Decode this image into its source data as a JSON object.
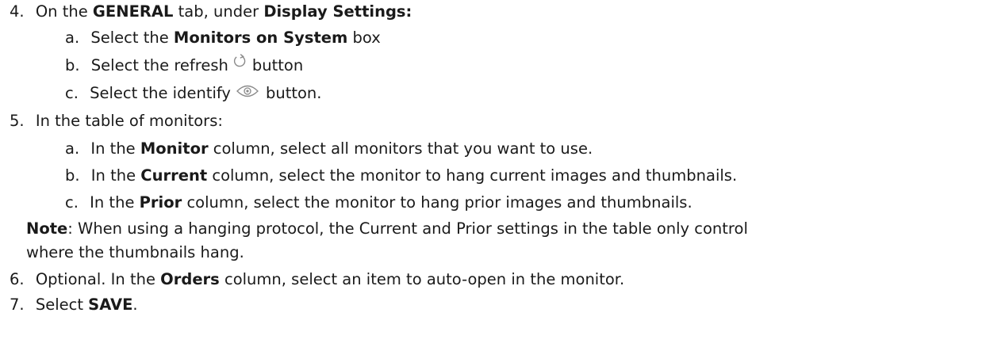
{
  "steps": [
    {
      "num": "4.",
      "parts": [
        "On the ",
        "GENERAL",
        " tab, under ",
        "Display Settings:"
      ],
      "substeps": [
        {
          "letter": "a.",
          "parts": [
            "Select the ",
            "Monitors on System",
            " box"
          ]
        },
        {
          "letter": "b.",
          "parts": [
            "Select the refresh",
            "button"
          ],
          "icon": "refresh-icon"
        },
        {
          "letter": "c.",
          "parts": [
            "Select the identify",
            "button."
          ],
          "icon": "eye-icon"
        }
      ]
    },
    {
      "num": "5.",
      "text": "In the table of monitors:",
      "substeps": [
        {
          "letter": "a.",
          "parts": [
            "In the ",
            "Monitor",
            " column, select all monitors that you want to use."
          ]
        },
        {
          "letter": "b.",
          "parts": [
            "In the ",
            "Current",
            " column, select the monitor to hang current images and thumbnails."
          ]
        },
        {
          "letter": "c.",
          "parts": [
            "In the ",
            "Prior",
            " column, select the monitor to hang prior images and thumbnails."
          ]
        }
      ],
      "note": {
        "label": "Note",
        "line1": ": When using a hanging protocol, the Current and Prior settings in the table only control",
        "line2": "where the thumbnails hang."
      }
    },
    {
      "num": "6.",
      "parts": [
        "Optional. In the ",
        "Orders",
        " column, select an item to auto-open in the monitor."
      ]
    },
    {
      "num": "7.",
      "parts": [
        "Select ",
        "SAVE",
        "."
      ]
    }
  ],
  "colors": {
    "text": "#1a1a1a",
    "icon": "#8a8a8a"
  }
}
